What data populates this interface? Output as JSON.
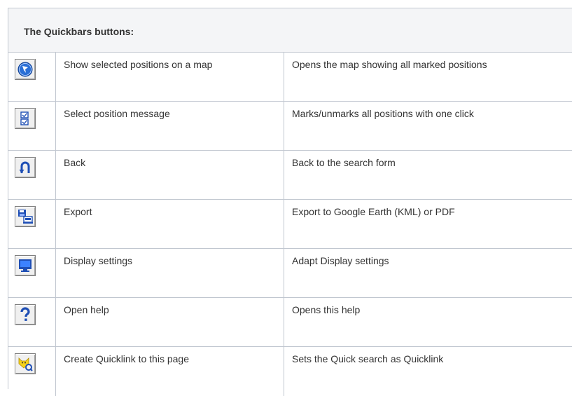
{
  "table": {
    "header": "The Quickbars buttons:",
    "rows": [
      {
        "icon": "globe-map-icon",
        "name": "Show selected positions on a map",
        "description": "Opens the map showing all marked positions"
      },
      {
        "icon": "checkbox-select-icon",
        "name": "Select position message",
        "description": "Marks/unmarks all positions with one click"
      },
      {
        "icon": "back-arrow-icon",
        "name": "Back",
        "description": "Back to the search form"
      },
      {
        "icon": "export-icon",
        "name": "Export",
        "description": "Export to Google Earth (KML) or PDF"
      },
      {
        "icon": "monitor-display-icon",
        "name": "Display settings",
        "description": "Adapt Display settings"
      },
      {
        "icon": "help-question-icon",
        "name": "Open help",
        "description": "Opens this help"
      },
      {
        "icon": "quicklink-fox-icon",
        "name": "Create Quicklink to this page",
        "description": "Sets the Quick search as Quicklink"
      }
    ]
  }
}
